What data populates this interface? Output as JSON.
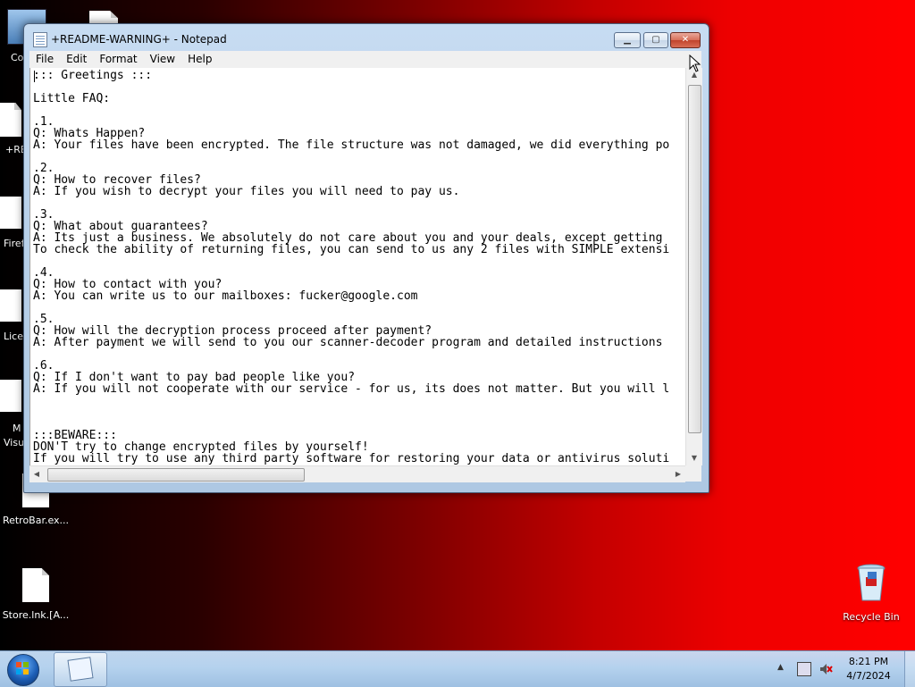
{
  "desktop": {
    "partial_labels": [
      "Co",
      "+RE",
      "Firef",
      "Lice",
      "M",
      "Visu"
    ],
    "icons": [
      {
        "label": "RetroBar.ex..."
      },
      {
        "label": "Store.lnk.[A..."
      }
    ],
    "recycle_bin": "Recycle Bin"
  },
  "window": {
    "title": "+README-WARNING+ - Notepad",
    "buttons": {
      "min": "▁",
      "max": "▢",
      "close": "✕"
    },
    "menu": [
      "File",
      "Edit",
      "Format",
      "View",
      "Help"
    ],
    "content_lines": [
      "::: Greetings :::",
      "",
      "Little FAQ:",
      "",
      ".1.",
      "Q: Whats Happen?",
      "A: Your files have been encrypted. The file structure was not damaged, we did everything po",
      "",
      ".2.",
      "Q: How to recover files?",
      "A: If you wish to decrypt your files you will need to pay us.",
      "",
      ".3.",
      "Q: What about guarantees?",
      "A: Its just a business. We absolutely do not care about you and your deals, except getting",
      "To check the ability of returning files, you can send to us any 2 files with SIMPLE extensi",
      "",
      ".4.",
      "Q: How to contact with you?",
      "A: You can write us to our mailboxes: fucker@google.com",
      "",
      ".5.",
      "Q: How will the decryption process proceed after payment?",
      "A: After payment we will send to you our scanner-decoder program and detailed instructions",
      "",
      ".6.",
      "Q: If I don't want to pay bad people like you?",
      "A: If you will not cooperate with our service - for us, its does not matter. But you will l",
      "",
      "",
      "",
      ":::BEWARE:::",
      "DON'T try to change encrypted files by yourself!",
      "If you will try to use any third party software for restoring your data or antivirus soluti"
    ]
  },
  "taskbar": {
    "clock_time": "8:21 PM",
    "clock_date": "4/7/2024",
    "tray_expand": "▲"
  },
  "colors": {
    "desktop_left": "#000000",
    "desktop_right": "#ff0000",
    "close_button": "#c1432b"
  }
}
